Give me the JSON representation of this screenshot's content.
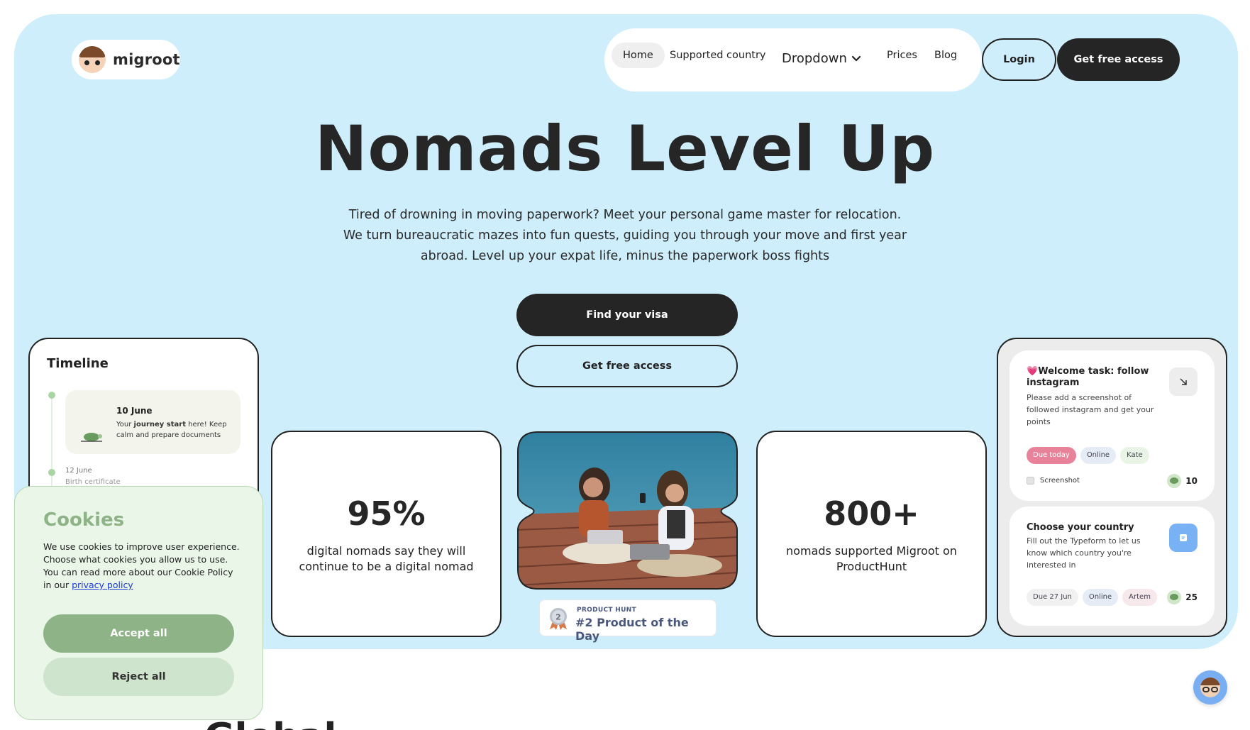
{
  "brand": {
    "name": "migroot"
  },
  "nav": {
    "items": [
      {
        "label": "Home",
        "active": true
      },
      {
        "label": "Supported country"
      },
      {
        "label": "Prices"
      },
      {
        "label": "Blog"
      }
    ],
    "dropdown_label": "Dropdown",
    "login_label": "Login",
    "cta_label": "Get free access"
  },
  "hero": {
    "title": "Nomads Level Up",
    "subtitle": "Tired of drowning in moving paperwork? Meet your personal game master for relocation. We turn bureaucratic mazes into fun quests, guiding you through your move and first year abroad. Level up your expat life, minus the paperwork boss fights",
    "primary_cta": "Find your visa",
    "secondary_cta": "Get free access"
  },
  "timeline": {
    "title": "Timeline",
    "entries": [
      {
        "date": "10 June",
        "text_pre": "Your ",
        "text_bold": "journey start",
        "text_post": " here! Keep calm and prepare documents"
      },
      {
        "date": "12 June",
        "text": "Birth certificate"
      }
    ]
  },
  "stats": [
    {
      "value": "95%",
      "label": "digital nomads say they will continue to be a digital nomad"
    },
    {
      "value": "800+",
      "label": "nomads supported Migroot on ProductHunt"
    }
  ],
  "product_hunt": {
    "small_label": "PRODUCT HUNT",
    "big_label": "#2 Product of the Day",
    "rank": "2"
  },
  "tasks": [
    {
      "emoji": "💗",
      "title": "Welcome task: follow instagram",
      "description": "Please add a screenshot of followed instagram and get your points",
      "tags": [
        "Due today",
        "Online",
        "Kate"
      ],
      "attachment": "Screenshot",
      "points": "10",
      "icon": "arrow-down-right-icon"
    },
    {
      "title": "Choose your country",
      "description": "Fill out the Typeform to let us know which country you're interested in",
      "tags": [
        "Due 27 Jun",
        "Online",
        "Artem"
      ],
      "points": "25",
      "icon": "form-icon"
    }
  ],
  "cookies": {
    "title": "Cookies",
    "text": "We use cookies to improve user experience. Choose what cookies you allow us to use. You can read more about our Cookie Policy in our ",
    "link": "privacy policy",
    "accept": "Accept all",
    "reject": "Reject all"
  },
  "section_heading_partial": "Global",
  "colors": {
    "hero_bg": "#cfeefb",
    "dark": "#252525",
    "cookie_bg": "#e9f6e8",
    "cookie_accent": "#8eb387",
    "tag_red": "#e8829a",
    "chat_bubble": "#7aaef2"
  }
}
